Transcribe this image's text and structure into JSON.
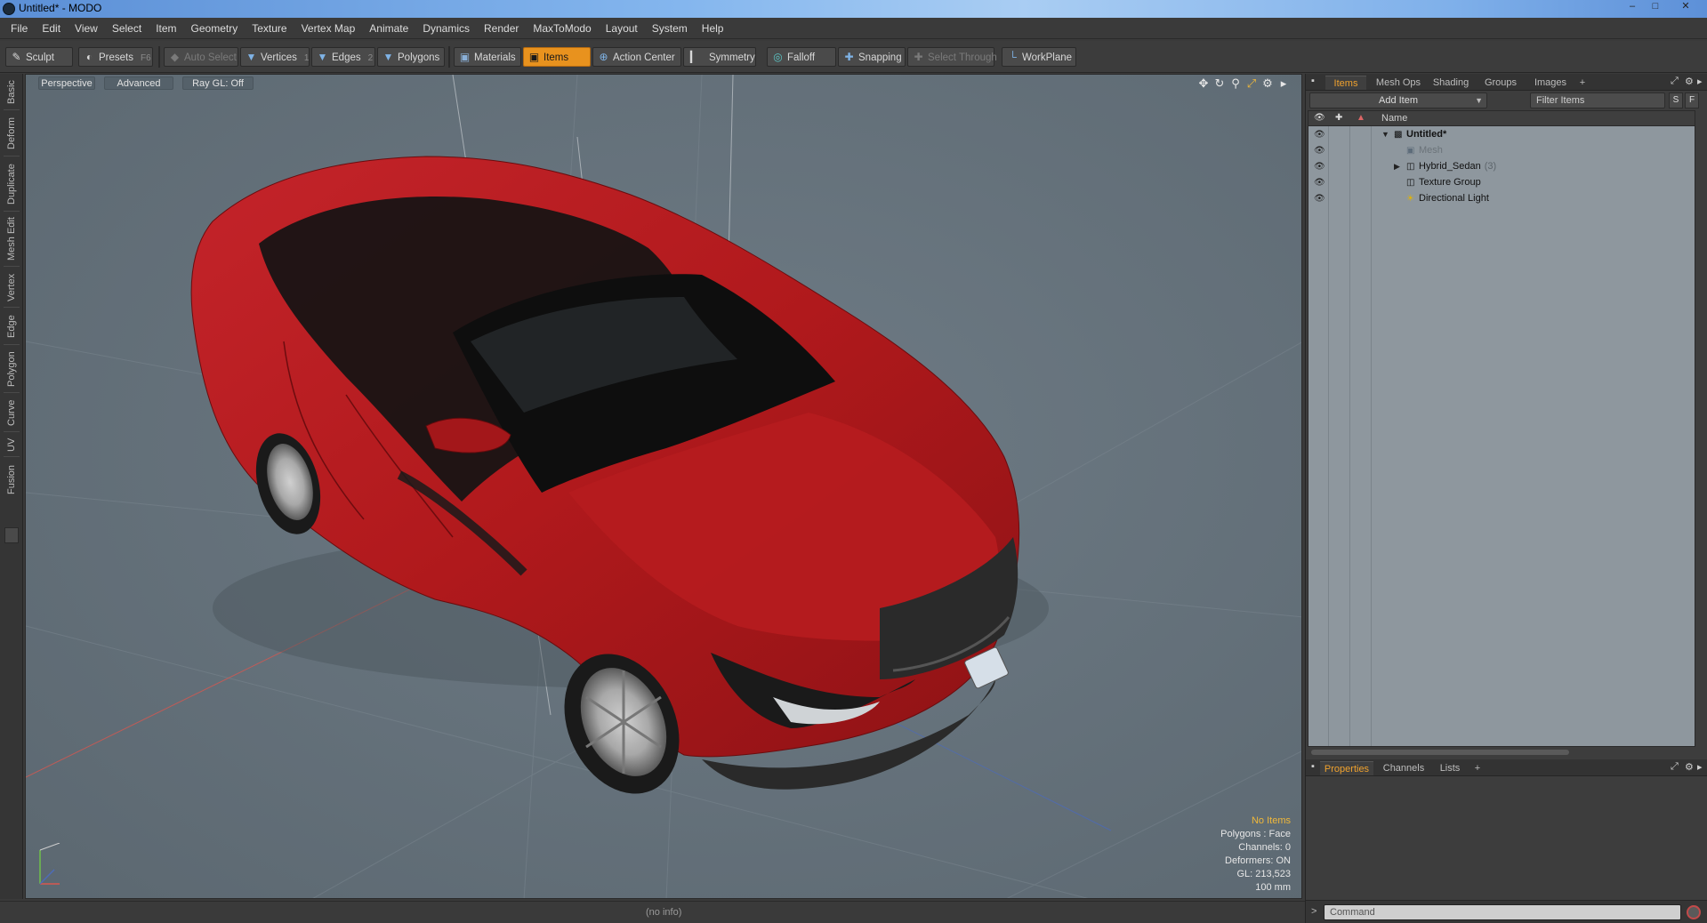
{
  "window": {
    "title": "Untitled* - MODO",
    "buttons": {
      "minimize": "–",
      "maximize": "□",
      "close": "✕"
    }
  },
  "menu": [
    "File",
    "Edit",
    "View",
    "Select",
    "Item",
    "Geometry",
    "Texture",
    "Vertex Map",
    "Animate",
    "Dynamics",
    "Render",
    "MaxToModo",
    "Layout",
    "System",
    "Help"
  ],
  "toolbar": {
    "sculpt": "Sculpt",
    "presets": "Presets",
    "presets_key": "F6",
    "auto_select": "Auto Select",
    "vertices": "Vertices",
    "vertices_key": "1",
    "edges": "Edges",
    "edges_key": "2",
    "polygons": "Polygons",
    "materials": "Materials",
    "items": "Items",
    "action_center": "Action Center",
    "symmetry": "Symmetry",
    "falloff": "Falloff",
    "snapping": "Snapping",
    "select_through": "Select Through",
    "workplane": "WorkPlane"
  },
  "left_tabs": [
    "Basic",
    "Deform",
    "Duplicate",
    "Mesh Edit",
    "Vertex",
    "Edge",
    "Polygon",
    "Curve",
    "UV",
    "Fusion"
  ],
  "viewport": {
    "view": "Perspective",
    "shading": "Advanced",
    "raygl": "Ray GL: Off",
    "stats": {
      "selection": "No Items",
      "polygons": "Polygons : Face",
      "channels": "Channels: 0",
      "deformers": "Deformers: ON",
      "gl": "GL: 213,523",
      "scale": "100 mm"
    },
    "car_color": "#b0191c"
  },
  "statusbar": {
    "info": "(no info)"
  },
  "right_panel": {
    "tabs": [
      "Items",
      "Mesh Ops",
      "Shading",
      "Groups",
      "Images"
    ],
    "add_item": "Add Item",
    "filter_placeholder": "Filter Items",
    "btn_s": "S",
    "btn_f": "F",
    "column_name": "Name",
    "tree": [
      {
        "label": "Untitled*",
        "kind": "scene"
      },
      {
        "label": "Mesh",
        "kind": "mesh"
      },
      {
        "label": "Hybrid_Sedan",
        "count": "(3)",
        "kind": "group"
      },
      {
        "label": "Texture Group",
        "kind": "texture"
      },
      {
        "label": "Directional Light",
        "kind": "light"
      }
    ],
    "lower_tabs": [
      "Properties",
      "Channels",
      "Lists"
    ],
    "command_placeholder": "Command",
    "command_prompt": ">"
  },
  "colors": {
    "accent": "#e8921e",
    "active_tab": "#f0a22e",
    "viewport_bg": "#65727c"
  }
}
